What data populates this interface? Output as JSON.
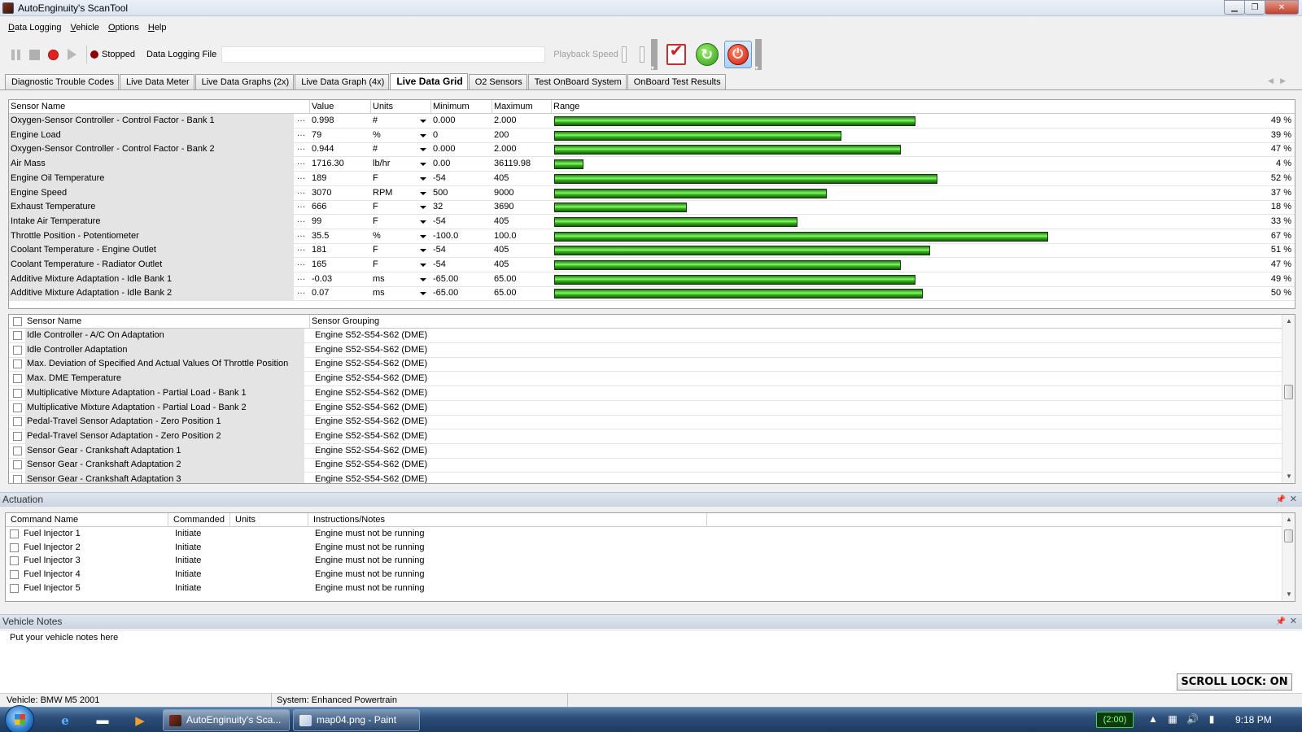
{
  "window": {
    "title": "AutoEnginuity's ScanTool"
  },
  "menu": [
    "Data Logging",
    "Vehicle",
    "Options",
    "Help"
  ],
  "toolbar": {
    "status": "Stopped",
    "logging_file_label": "Data Logging File",
    "logging_file_value": "",
    "playback_label": "Playback Speed"
  },
  "tabs": [
    "Diagnostic Trouble Codes",
    "Live Data Meter",
    "Live Data Graphs (2x)",
    "Live Data Graph (4x)",
    "Live Data Grid",
    "O2 Sensors",
    "Test OnBoard System",
    "OnBoard Test Results"
  ],
  "active_tab": "Live Data Grid",
  "live_grid": {
    "headers": {
      "name": "Sensor Name",
      "value": "Value",
      "units": "Units",
      "min": "Minimum",
      "max": "Maximum",
      "range": "Range"
    },
    "rows": [
      {
        "name": "Oxygen-Sensor Controller - Control Factor - Bank 1",
        "value": "0.998",
        "units": "#",
        "min": "0.000",
        "max": "2.000",
        "pct": 49,
        "pct_label": "49 %"
      },
      {
        "name": "Engine Load",
        "value": "79",
        "units": "%",
        "min": "0",
        "max": "200",
        "pct": 39,
        "pct_label": "39 %"
      },
      {
        "name": "Oxygen-Sensor Controller - Control Factor - Bank 2",
        "value": "0.944",
        "units": "#",
        "min": "0.000",
        "max": "2.000",
        "pct": 47,
        "pct_label": "47 %"
      },
      {
        "name": "Air Mass",
        "value": "1716.30",
        "units": "lb/hr",
        "min": "0.00",
        "max": "36119.98",
        "pct": 4,
        "pct_label": "4 %"
      },
      {
        "name": "Engine Oil Temperature",
        "value": "189",
        "units": "F",
        "min": "-54",
        "max": "405",
        "pct": 52,
        "pct_label": "52 %"
      },
      {
        "name": "Engine Speed",
        "value": "3070",
        "units": "RPM",
        "min": "500",
        "max": "9000",
        "pct": 37,
        "pct_label": "37 %"
      },
      {
        "name": "Exhaust Temperature",
        "value": "666",
        "units": "F",
        "min": "32",
        "max": "3690",
        "pct": 18,
        "pct_label": "18 %"
      },
      {
        "name": "Intake Air Temperature",
        "value": "99",
        "units": "F",
        "min": "-54",
        "max": "405",
        "pct": 33,
        "pct_label": "33 %"
      },
      {
        "name": "Throttle Position - Potentiometer",
        "value": "35.5",
        "units": "%",
        "min": "-100.0",
        "max": "100.0",
        "pct": 67,
        "pct_label": "67 %"
      },
      {
        "name": "Coolant Temperature - Engine Outlet",
        "value": "181",
        "units": "F",
        "min": "-54",
        "max": "405",
        "pct": 51,
        "pct_label": "51 %"
      },
      {
        "name": "Coolant Temperature - Radiator Outlet",
        "value": "165",
        "units": "F",
        "min": "-54",
        "max": "405",
        "pct": 47,
        "pct_label": "47 %"
      },
      {
        "name": "Additive Mixture Adaptation - Idle Bank 1",
        "value": "-0.03",
        "units": "ms",
        "min": "-65.00",
        "max": "65.00",
        "pct": 49,
        "pct_label": "49 %"
      },
      {
        "name": "Additive Mixture Adaptation - Idle Bank 2",
        "value": "0.07",
        "units": "ms",
        "min": "-65.00",
        "max": "65.00",
        "pct": 50,
        "pct_label": "50 %"
      }
    ]
  },
  "sensor_list": {
    "headers": {
      "name": "Sensor Name",
      "group": "Sensor Grouping"
    },
    "rows": [
      {
        "name": "Idle Controller - A/C On Adaptation",
        "group": "Engine S52-S54-S62 (DME)"
      },
      {
        "name": "Idle Controller Adaptation",
        "group": "Engine S52-S54-S62 (DME)"
      },
      {
        "name": "Max. Deviation of Specified And Actual Values Of Throttle Position",
        "group": "Engine S52-S54-S62 (DME)"
      },
      {
        "name": "Max. DME Temperature",
        "group": "Engine S52-S54-S62 (DME)"
      },
      {
        "name": "Multiplicative Mixture Adaptation - Partial Load - Bank 1",
        "group": "Engine S52-S54-S62 (DME)"
      },
      {
        "name": "Multiplicative Mixture Adaptation - Partial Load - Bank 2",
        "group": "Engine S52-S54-S62 (DME)"
      },
      {
        "name": "Pedal-Travel Sensor Adaptation - Zero Position 1",
        "group": "Engine S52-S54-S62 (DME)"
      },
      {
        "name": "Pedal-Travel Sensor Adaptation - Zero Position 2",
        "group": "Engine S52-S54-S62 (DME)"
      },
      {
        "name": "Sensor Gear - Crankshaft  Adaptation  1",
        "group": "Engine S52-S54-S62 (DME)"
      },
      {
        "name": "Sensor Gear - Crankshaft  Adaptation  2",
        "group": "Engine S52-S54-S62 (DME)"
      },
      {
        "name": "Sensor Gear - Crankshaft  Adaptation  3",
        "group": "Engine S52-S54-S62 (DME)"
      }
    ]
  },
  "actuation": {
    "title": "Actuation",
    "headers": {
      "command": "Command Name",
      "commanded": "Commanded",
      "units": "Units",
      "notes": "Instructions/Notes"
    },
    "rows": [
      {
        "command": "Fuel Injector 1",
        "commanded": "Initiate",
        "units": "",
        "notes": "Engine must not be running"
      },
      {
        "command": "Fuel Injector 2",
        "commanded": "Initiate",
        "units": "",
        "notes": "Engine must not be running"
      },
      {
        "command": "Fuel Injector 3",
        "commanded": "Initiate",
        "units": "",
        "notes": "Engine must not be running"
      },
      {
        "command": "Fuel Injector 4",
        "commanded": "Initiate",
        "units": "",
        "notes": "Engine must not be running"
      },
      {
        "command": "Fuel Injector 5",
        "commanded": "Initiate",
        "units": "",
        "notes": "Engine must not be running"
      }
    ]
  },
  "vehicle_notes": {
    "title": "Vehicle Notes",
    "text": "Put your vehicle notes here"
  },
  "scroll_lock": "SCROLL LOCK: ON",
  "statusbar": {
    "vehicle": "Vehicle: BMW  M5  2001",
    "system": "System: Enhanced Powertrain"
  },
  "taskbar": {
    "tasks": [
      "AutoEnginuity's Sca...",
      "map04.png - Paint"
    ],
    "timer": "(2:00)",
    "clock": "9:18 PM"
  }
}
